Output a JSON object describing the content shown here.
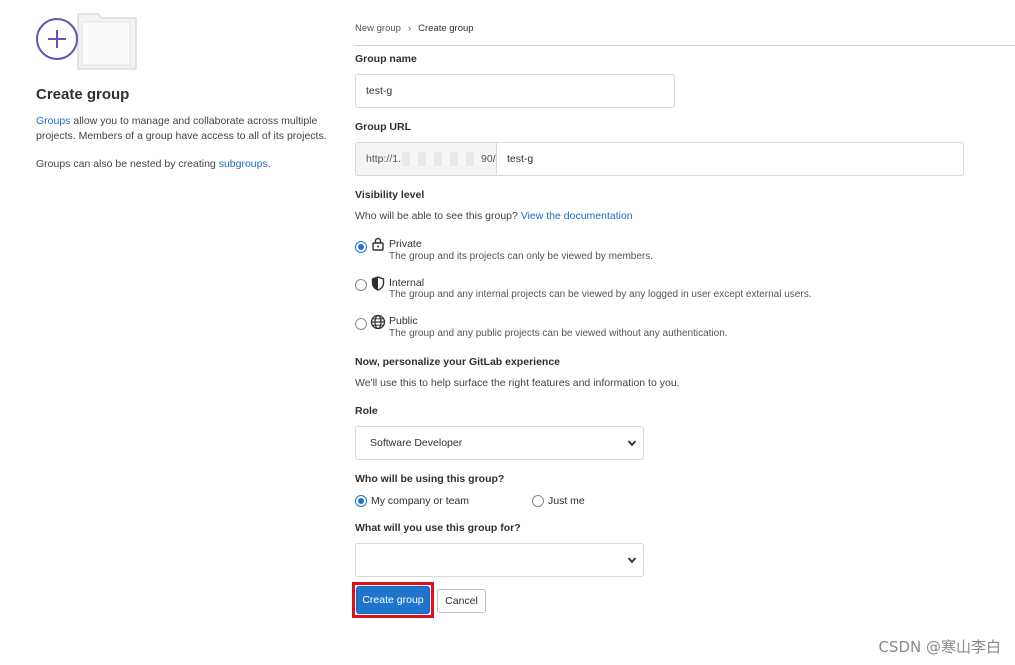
{
  "left": {
    "title": "Create group",
    "desc_link": "Groups",
    "desc_text": " allow you to manage and collaborate across multiple projects. Members of a group have access to all of its projects.",
    "nested_text": "Groups can also be nested by creating ",
    "nested_link": "subgroups",
    "nested_end": "."
  },
  "breadcrumb": {
    "parent": "New group",
    "separator": "›",
    "current": "Create group"
  },
  "form": {
    "group_name_label": "Group name",
    "group_name_value": "test-g",
    "group_url_label": "Group URL",
    "url_prefix_start": "http://1.",
    "url_prefix_end": "90/",
    "url_slug_value": "test-g",
    "visibility_label": "Visibility level",
    "visibility_help": "Who will be able to see this group? ",
    "visibility_doc_link": "View the documentation",
    "visibility": [
      {
        "title": "Private",
        "desc": "The group and its projects can only be viewed by members.",
        "icon": "lock-icon",
        "selected": true
      },
      {
        "title": "Internal",
        "desc": "The group and any internal projects can be viewed by any logged in user except external users.",
        "icon": "shield-icon",
        "selected": false
      },
      {
        "title": "Public",
        "desc": "The group and any public projects can be viewed without any authentication.",
        "icon": "globe-icon",
        "selected": false
      }
    ],
    "personalize_title": "Now, personalize your GitLab experience",
    "personalize_help": "We'll use this to help surface the right features and information to you.",
    "role_label": "Role",
    "role_selected": "Software Developer",
    "who_label": "Who will be using this group?",
    "who_options": [
      "My company or team",
      "Just me"
    ],
    "who_selected": 0,
    "use_label": "What will you use this group for?",
    "use_selected": ""
  },
  "buttons": {
    "create": "Create group",
    "cancel": "Cancel"
  },
  "watermark": "CSDN @寒山李白",
  "colors": {
    "primary": "#1f75cb",
    "link": "#1f6bbf",
    "highlight": "#e0101a",
    "illustration_accent": "#6b4fbb"
  }
}
